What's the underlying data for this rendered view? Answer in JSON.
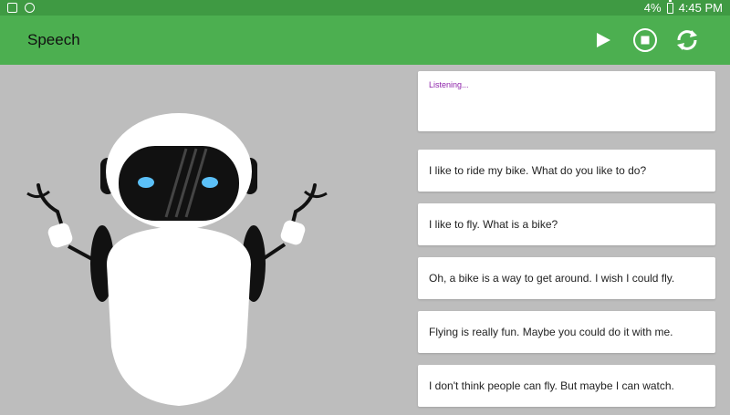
{
  "status_bar": {
    "battery_text": "4%",
    "time": "4:45 PM"
  },
  "app_bar": {
    "title": "Speech",
    "icons": [
      "play-icon",
      "stop-icon",
      "refresh-icon"
    ]
  },
  "listening": {
    "text": "Listening..."
  },
  "messages": [
    "I like to ride my bike. What do you like to do?",
    "I like to fly. What is a bike?",
    "Oh, a bike is a way to get around. I wish I could fly.",
    "Flying is really fun. Maybe you could do it with me.",
    "I don't think people can fly. But maybe I can watch."
  ],
  "colors": {
    "status_bar": "#3f9a43",
    "app_bar": "#4caf50",
    "background": "#bdbdbd",
    "listening_text": "#8e24aa",
    "robot_eye": "#5bc0f8"
  }
}
